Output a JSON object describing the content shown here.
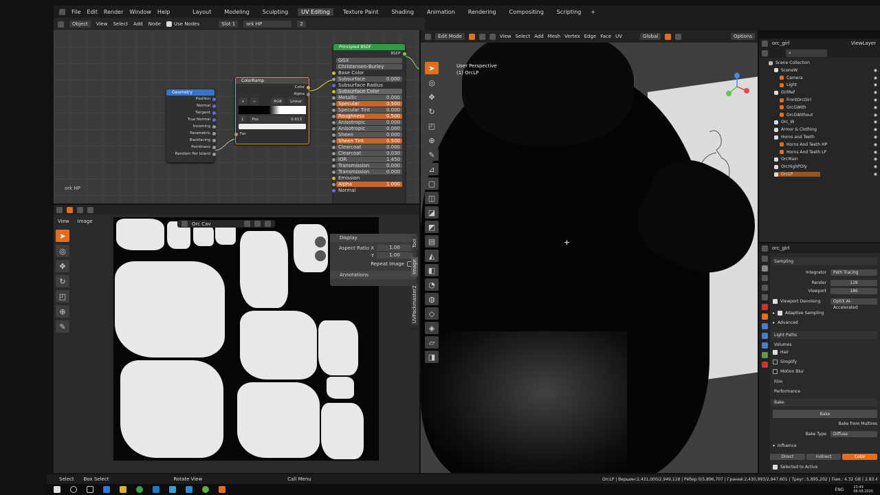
{
  "menu": {
    "items": [
      "File",
      "Edit",
      "Render",
      "Window",
      "Help"
    ],
    "workspaces": [
      "Layout",
      "Modeling",
      "Sculpting",
      "UV Editing",
      "Texture Paint",
      "Shading",
      "Animation",
      "Rendering",
      "Compositing",
      "Scripting"
    ],
    "active_workspace": "UV Editing"
  },
  "node_header": {
    "object_mode": "Object",
    "view": "View",
    "select": "Select",
    "add": "Add",
    "node": "Node",
    "use_nodes": "Use Nodes",
    "slot": "Slot 1",
    "material": "ork HP",
    "users": "2"
  },
  "node_editor": {
    "material_label": "ork HP",
    "geometry": {
      "title": "Geometry",
      "outputs": [
        "Position",
        "Normal",
        "Tangent",
        "True Normal",
        "Incoming",
        "Parametric",
        "Backfacing",
        "Pointiness",
        "Random Per Island"
      ]
    },
    "colorramp": {
      "title": "ColorRamp",
      "outputs": [
        "Color",
        "Alpha"
      ],
      "mode": "RGB",
      "interp": "Linear",
      "index": "1",
      "pos_label": "Pos",
      "pos_value": "0.613",
      "input": "Fac"
    },
    "bsdf": {
      "title": "Principled BSDF",
      "output": "BSDF",
      "distribution": "GGX",
      "sss_method": "Christensen-Burley",
      "rows": [
        {
          "label": "Base Color",
          "value": ""
        },
        {
          "label": "Subsurface",
          "value": "0.000"
        },
        {
          "label": "Subsurface Radius",
          "value": ""
        },
        {
          "label": "Subsurface Color",
          "value": ""
        },
        {
          "label": "Metallic",
          "value": "0.000"
        },
        {
          "label": "Specular",
          "value": "0.500"
        },
        {
          "label": "Specular Tint",
          "value": "0.000"
        },
        {
          "label": "Roughness",
          "value": "0.500"
        },
        {
          "label": "Anisotropic",
          "value": "0.000"
        },
        {
          "label": "Anisotropic Rotation",
          "value": "0.000"
        },
        {
          "label": "Sheen",
          "value": "0.000"
        },
        {
          "label": "Sheen Tint",
          "value": "0.500"
        },
        {
          "label": "Clearcoat",
          "value": "0.000"
        },
        {
          "label": "Clearcoat Roughness",
          "value": "0.030"
        },
        {
          "label": "IOR",
          "value": "1.450"
        },
        {
          "label": "Transmission",
          "value": "0.000"
        },
        {
          "label": "Transmission Roughness",
          "value": "0.000"
        },
        {
          "label": "Emission",
          "value": ""
        },
        {
          "label": "Alpha",
          "value": "1.000"
        },
        {
          "label": "Normal",
          "value": ""
        }
      ]
    }
  },
  "image_editor": {
    "view": "View",
    "image": "Image",
    "image_name": "Orc Cav",
    "display_panel": {
      "title": "Display",
      "aspect_label": "Aspect Ratio X",
      "aspect_x": "1.00",
      "y_label": "Y",
      "aspect_y": "1.00",
      "repeat": "Repeat Image",
      "annotations": "Annotations"
    },
    "side_tabs": [
      "Tool",
      "Image",
      "UVPackmaster2"
    ]
  },
  "viewport": {
    "mode": "Edit Mode",
    "view": "View",
    "select": "Select",
    "add": "Add",
    "mesh": "Mesh",
    "vertex": "Vertex",
    "edge": "Edge",
    "face": "Face",
    "uv": "UV",
    "orientation": "Global",
    "options": "Options",
    "perspective": "User Perspective",
    "object": "(1) OrcLP"
  },
  "outliner": {
    "object_name": "orc_girl",
    "view_layer": "ViewLayer",
    "items": [
      {
        "label": "Scene Collection",
        "depth": 0
      },
      {
        "label": "SceneW",
        "depth": 1
      },
      {
        "label": "Camera",
        "depth": 2
      },
      {
        "label": "Light",
        "depth": 2
      },
      {
        "label": "GirlRef",
        "depth": 1
      },
      {
        "label": "FrontOrcGirl",
        "depth": 2
      },
      {
        "label": "OrcGWith",
        "depth": 2
      },
      {
        "label": "OrcGWithout",
        "depth": 2
      },
      {
        "label": "Orc_W",
        "depth": 1
      },
      {
        "label": "Armor & Clothing",
        "depth": 1
      },
      {
        "label": "Horns and Teeth",
        "depth": 1
      },
      {
        "label": "Horns And Teeth HP",
        "depth": 2
      },
      {
        "label": "Horns And Teeth LP",
        "depth": 2
      },
      {
        "label": "OrcMain",
        "depth": 1
      },
      {
        "label": "OrcHighPOly",
        "depth": 1
      },
      {
        "label": "OrcLP",
        "depth": 1
      }
    ]
  },
  "properties": {
    "object_name": "orc_girl",
    "sampling": "Sampling",
    "integrator_label": "Integrator",
    "integrator": "Path Tracing",
    "render_label": "Render",
    "render": "128",
    "viewport_label": "Viewport",
    "viewport": "186",
    "denoising_label": "Viewport Denoising",
    "denoising": "OptiX AI-Accelerated",
    "adaptive": "Adaptive Sampling",
    "advanced": "Advanced",
    "light_paths": "Light Paths",
    "volumes": "Volumes",
    "hair": "Hair",
    "simplify": "Simplify",
    "motion_blur": "Motion Blur",
    "film": "Film",
    "performance": "Performance",
    "bake_section": "Bake",
    "bake_button": "Bake",
    "bake_multires": "Bake from Multires",
    "bake_type_label": "Bake Type",
    "bake_type": "Diffuse",
    "influence": "Influence",
    "influence_tabs": [
      "Direct",
      "Indirect",
      "Color"
    ],
    "selected_active": "Selected to Active"
  },
  "status": {
    "select": "Select",
    "box_select": "Box Select",
    "rotate": "Rotate View",
    "call_menu": "Call Menu",
    "stats": "OrcLP | Вершин:2,431,000/2,949,118 | Рёбер:0/5,896,707 | Граней:2,430,993/2,947,601 | Треуг.:5,895,202 | Пам.: 4.32 GB | 2.83.4"
  },
  "taskbar": {
    "lang": "ENG",
    "time": "23:49",
    "date": "06.08.2020"
  },
  "colors": {
    "accent": "#e07020",
    "bsdf_header": "#2f9b44",
    "colorramp_header": "#3a3a3a",
    "geometry_header": "#3575c9"
  }
}
